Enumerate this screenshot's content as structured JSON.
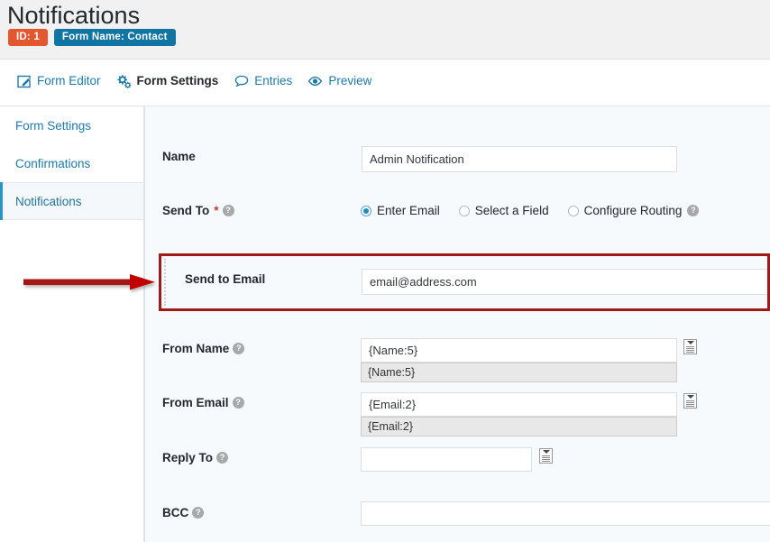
{
  "header": {
    "title": "Notifications",
    "badges": [
      {
        "name": "id-badge",
        "label": "ID: 1",
        "color": "#e4572e"
      },
      {
        "name": "form-name-badge",
        "label": "Form Name: Contact",
        "color": "#1075a3"
      }
    ]
  },
  "nav": {
    "items": [
      {
        "label": "Form Editor",
        "icon": "pencil-square-icon",
        "active": false
      },
      {
        "label": "Form Settings",
        "icon": "gears-icon",
        "active": true
      },
      {
        "label": "Entries",
        "icon": "comment-icon",
        "active": false
      },
      {
        "label": "Preview",
        "icon": "eye-icon",
        "active": false
      }
    ]
  },
  "sidebar": {
    "items": [
      {
        "label": "Form Settings",
        "active": false
      },
      {
        "label": "Confirmations",
        "active": false
      },
      {
        "label": "Notifications",
        "active": true
      }
    ],
    "active_accent": "#2a93c9"
  },
  "form": {
    "name": {
      "label": "Name",
      "value": "Admin Notification"
    },
    "send_to": {
      "label": "Send To",
      "required_marker": "*",
      "help_icon": "help-circle-icon",
      "options": [
        {
          "label": "Enter Email",
          "selected": true
        },
        {
          "label": "Select a Field",
          "selected": false
        },
        {
          "label": "Configure Routing",
          "selected": false,
          "help_icon": "help-circle-icon"
        }
      ]
    },
    "send_to_email": {
      "label": "Send to Email",
      "value": "email@address.com",
      "highlighted": true,
      "highlight_color": "#a01a1a"
    },
    "from_name": {
      "label": "From Name",
      "value": "{Name:5}",
      "suggestion": "{Name:5}",
      "merge_tag_icon": "merge-tag-icon"
    },
    "from_email": {
      "label": "From Email",
      "value": "{Email:2}",
      "suggestion": "{Email:2}",
      "merge_tag_icon": "merge-tag-icon"
    },
    "reply_to": {
      "label": "Reply To",
      "value": "",
      "merge_tag_icon": "merge-tag-icon"
    },
    "bcc": {
      "label": "BCC",
      "value": ""
    }
  },
  "annotation": {
    "arrow": {
      "name": "red-arrow-pointer",
      "color": "#a51616",
      "direction": "right"
    }
  }
}
